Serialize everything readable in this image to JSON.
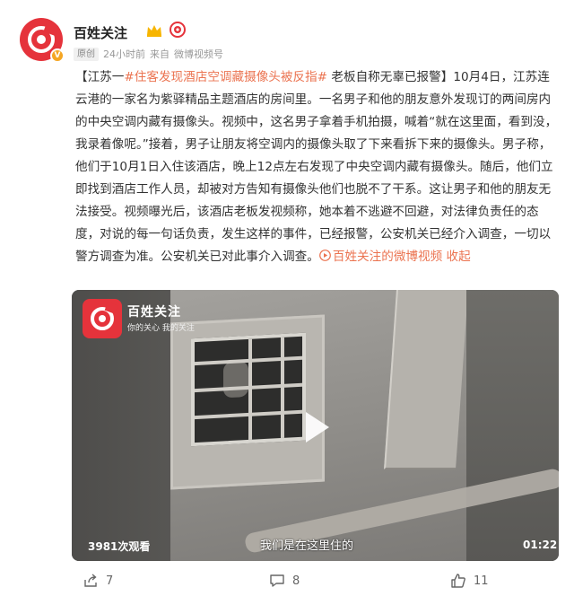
{
  "post": {
    "author": "百姓关注",
    "verified_badge": "V",
    "meta": {
      "tag": "原创",
      "time": "24小时前",
      "source_prefix": "来自",
      "source": "微博视频号"
    },
    "text": {
      "prefix": "【江苏一",
      "hashtag": "#住客发现酒店空调藏摄像头被反指#",
      "body": " 老板自称无辜已报警】10月4日，江苏连云港的一家名为紫驿精品主题酒店的房间里。一名男子和他的朋友意外发现订的两间房内的中央空调内藏有摄像头。视频中，这名男子拿着手机拍摄，喊着“就在这里面，看到没，我录着像呢。”接着，男子让朋友将空调内的摄像头取了下来看拆下来的摄像头。男子称，他们于10月1日入住该酒店，晚上12点左右发现了中央空调内藏有摄像头。随后，他们立即找到酒店工作人员，却被对方告知有摄像头他们也脱不了干系。这让男子和他的朋友无法接受。视频曝光后，该酒店老板发视频称，她本着不逃避不回避，对法律负责任的态度，对说的每一句话负责，发生这样的事件，已经报警，公安机关已经介入调查，一切以警方调查为准。公安机关已对此事介入调查。",
      "video_link": "百姓关注的微博视频",
      "collapse": "收起"
    },
    "video": {
      "brand": "百姓关注",
      "slogan": "你的关心 我的关注",
      "views": "3981次观看",
      "subtitle": "我们是在这里住的",
      "duration": "01:22"
    },
    "actions": {
      "share_count": "7",
      "comment_count": "8",
      "like_count": "11"
    }
  },
  "colors": {
    "accent": "#eb7350",
    "brand_red": "#e5333b",
    "meta_gray": "#999999"
  },
  "icons": [
    "avatar-logo",
    "crown-icon",
    "badge-icon",
    "play-icon",
    "share-icon",
    "comment-icon",
    "like-icon"
  ]
}
